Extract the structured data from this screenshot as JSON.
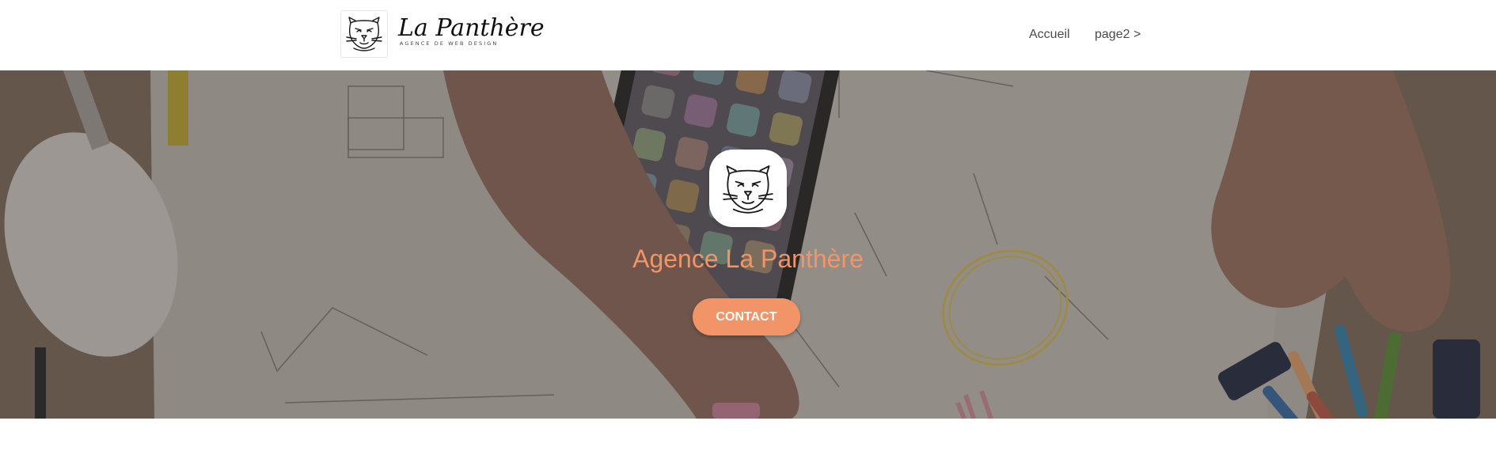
{
  "header": {
    "logo": {
      "title": "La Panthère",
      "tagline": "AGENCE DE WEB DESIGN",
      "icon": "panther-head-icon"
    },
    "nav": [
      {
        "label": "Accueil"
      },
      {
        "label": "page2 >"
      }
    ]
  },
  "hero": {
    "background": "desk-sketches-photo",
    "logo_icon": "panther-head-icon",
    "title": "Agence La Panthère",
    "button_label": "CONTACT"
  },
  "colors": {
    "accent": "#f19468",
    "title": "#f39466",
    "nav_text": "#4a4a4a",
    "header_bg": "#ffffff"
  }
}
